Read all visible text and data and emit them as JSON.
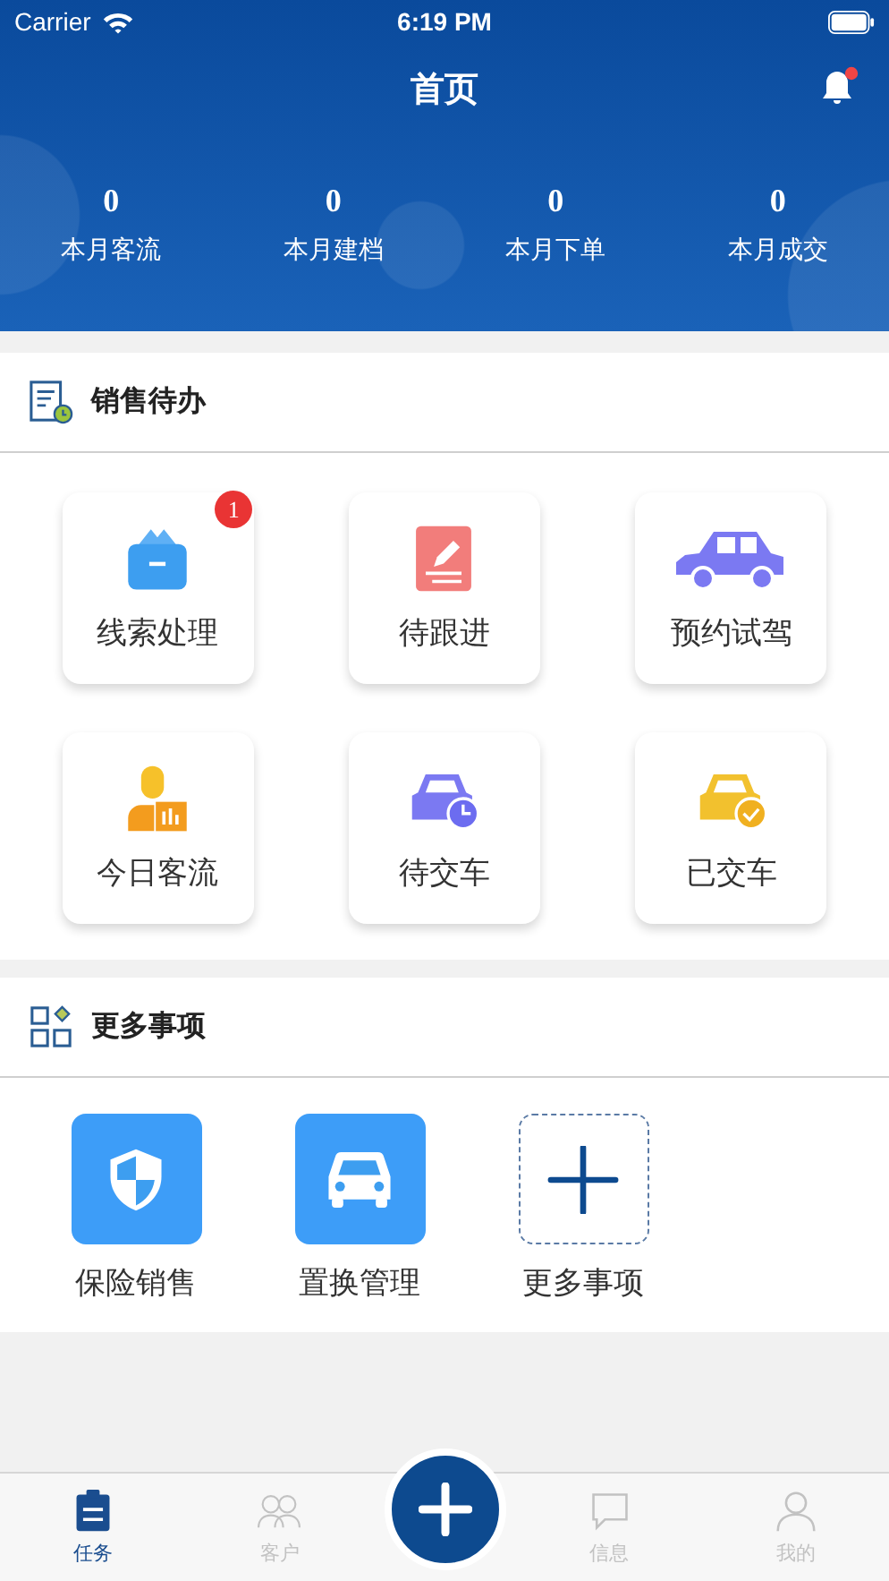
{
  "status_bar": {
    "carrier": "Carrier",
    "time": "6:19 PM"
  },
  "nav": {
    "title": "首页",
    "notifications_unread": true
  },
  "stats": [
    {
      "value": "0",
      "label": "本月客流"
    },
    {
      "value": "0",
      "label": "本月建档"
    },
    {
      "value": "0",
      "label": "本月下单"
    },
    {
      "value": "0",
      "label": "本月成交"
    }
  ],
  "sales_todo": {
    "title": "销售待办",
    "items": [
      {
        "label": "线索处理",
        "badge": "1"
      },
      {
        "label": "待跟进"
      },
      {
        "label": "预约试驾"
      },
      {
        "label": "今日客流"
      },
      {
        "label": "待交车"
      },
      {
        "label": "已交车"
      }
    ]
  },
  "more": {
    "title": "更多事项",
    "items": [
      {
        "label": "保险销售",
        "kind": "app"
      },
      {
        "label": "置换管理",
        "kind": "app"
      },
      {
        "label": "更多事项",
        "kind": "add"
      }
    ]
  },
  "tab_bar": [
    {
      "label": "任务",
      "selected": true
    },
    {
      "label": "客户",
      "selected": false
    },
    {
      "label": "信息",
      "selected": false
    },
    {
      "label": "我的",
      "selected": false
    }
  ]
}
